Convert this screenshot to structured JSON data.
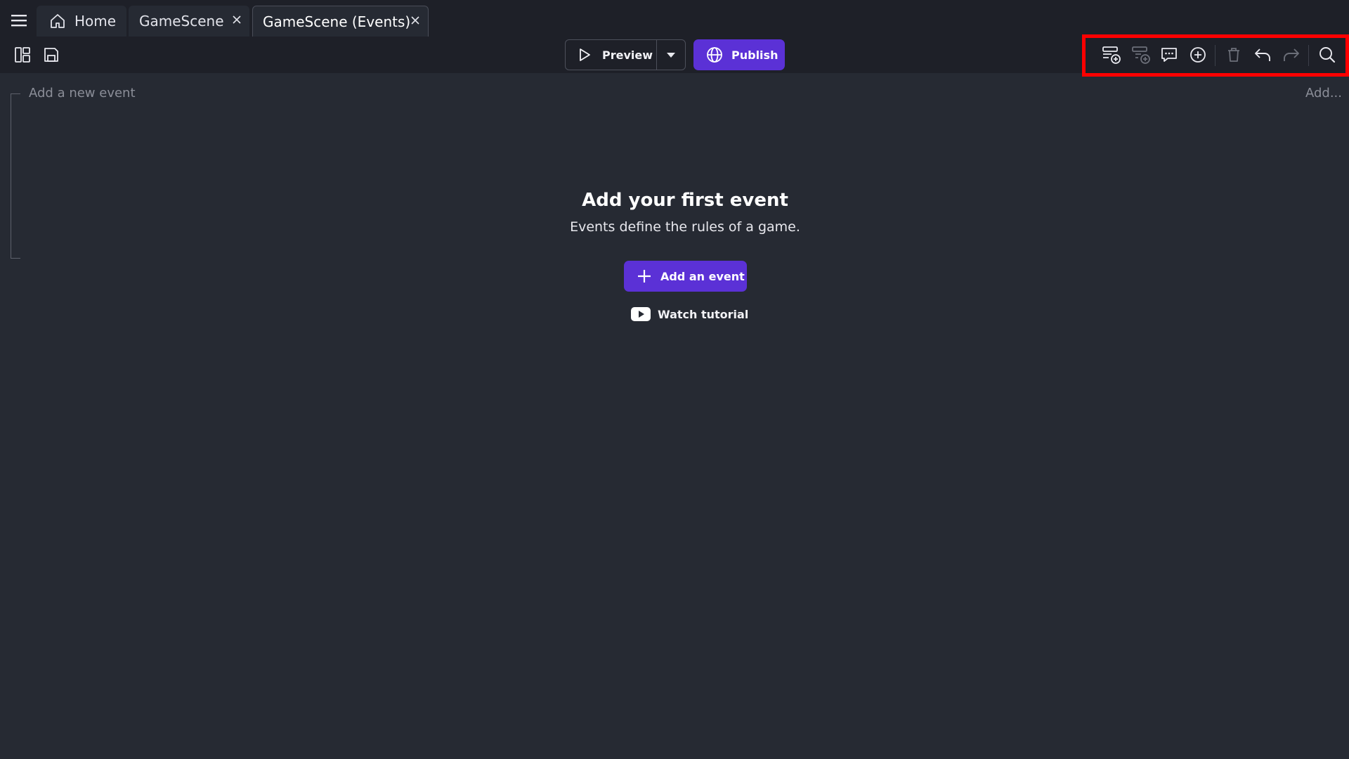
{
  "tabs": [
    {
      "label": "Home",
      "icon": "home-icon"
    },
    {
      "label": "GameScene",
      "icon": "close-icon"
    },
    {
      "label": "GameScene (Events)",
      "icon": "close-icon"
    }
  ],
  "toolbar": {
    "preview_label": "Preview",
    "publish_label": "Publish",
    "right_icons": [
      "add-event-icon",
      "add-sub-event-icon",
      "add-comment-icon",
      "add-icon",
      "delete-icon",
      "undo-icon",
      "redo-icon",
      "search-icon"
    ]
  },
  "events": {
    "add_new_event": "Add a new event",
    "add_ellipsis": "Add..."
  },
  "empty_state": {
    "title": "Add your first event",
    "subtitle": "Events define the rules of a game.",
    "add_button_label": "Add an event",
    "tutorial_label": "Watch tutorial"
  },
  "colors": {
    "accent": "#5b31d6",
    "background": "#262a33",
    "bar": "#1e2028",
    "highlight": "#ff0000"
  }
}
